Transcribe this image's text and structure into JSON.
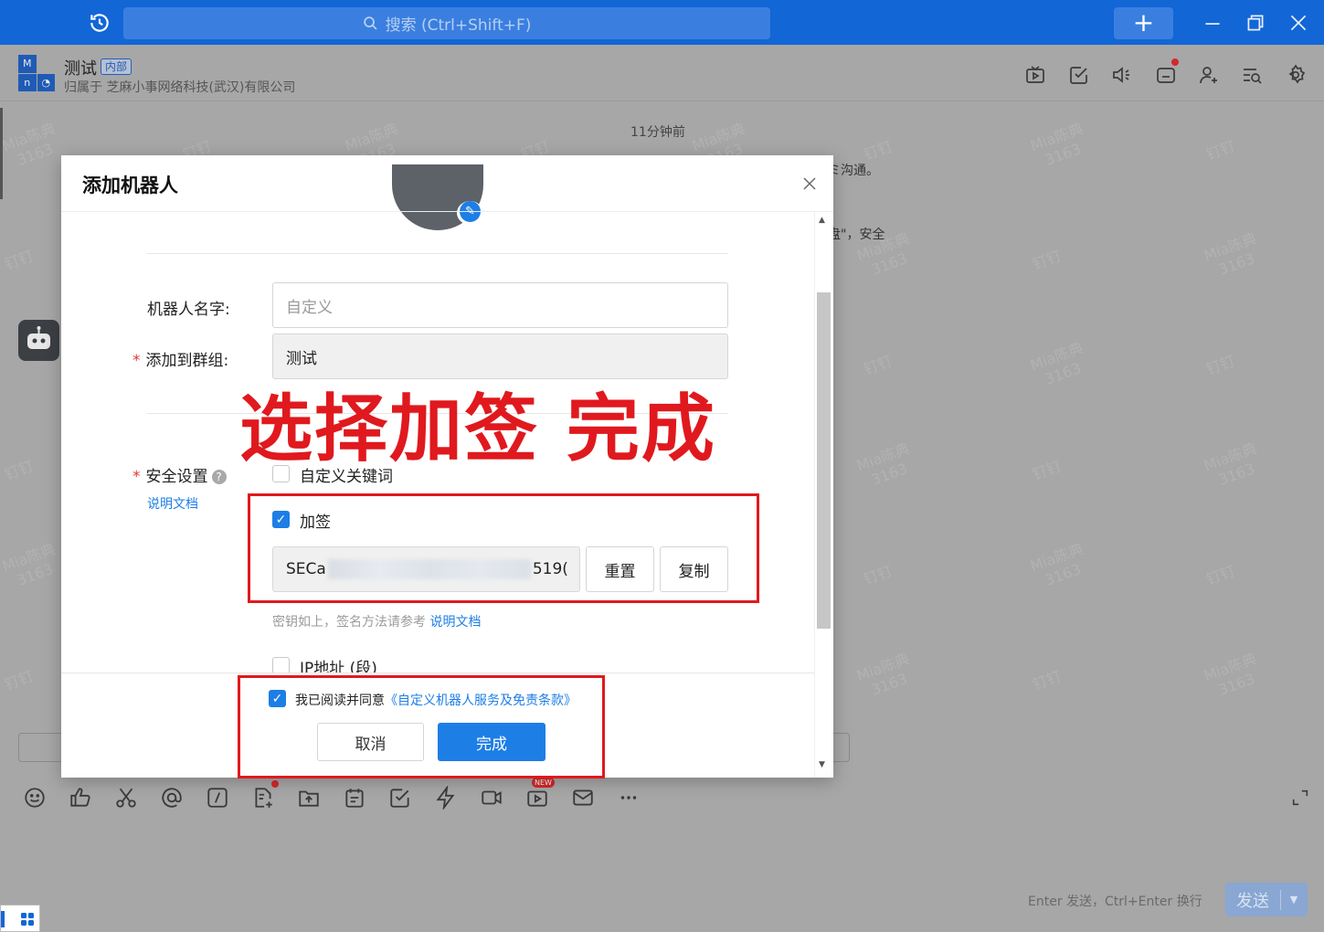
{
  "topbar": {
    "search_placeholder": "搜索 (Ctrl+Shift+F)",
    "new_label": "+"
  },
  "chat": {
    "group_avatar_letters": [
      "M",
      "",
      "n",
      ""
    ],
    "group_name": "测试",
    "badge": "内部",
    "belongs_to": "归属于 芝麻小事网络科技(武汉)有限公司",
    "timestamp": "11分钟前",
    "msg_fragment_1": "ミ沟通。",
    "msg_fragment_2": "盘\"，安全",
    "watermark_name": "Mia陈典",
    "watermark_id": "3163",
    "watermark_brand": "钉钉"
  },
  "toolbar": {
    "new_badge": "NEW",
    "send_hint": "Enter 发送，Ctrl+Enter 换行",
    "send_label": "发送"
  },
  "modal": {
    "title": "添加机器人",
    "name_label": "机器人名字:",
    "name_placeholder": "自定义",
    "group_label": "添加到群组:",
    "group_value": "测试",
    "security_label": "安全设置",
    "doc_link": "说明文档",
    "option_keyword": "自定义关键词",
    "option_sign": "加签",
    "secret_prefix": "SECa",
    "secret_suffix": "519(",
    "reset_label": "重置",
    "copy_label": "复制",
    "hint_text": "密钥如上，签名方法请参考",
    "hint_link": "说明文档",
    "option_ip": "IP地址 (段)",
    "agree_text": "我已阅读并同意",
    "agree_link": "《自定义机器人服务及免责条款》",
    "cancel_label": "取消",
    "done_label": "完成"
  },
  "annotation": {
    "text": "选择加签  完成",
    "color": "#e0191e"
  },
  "colors": {
    "brand_blue": "#1266d6",
    "primary": "#1d7ee6"
  }
}
